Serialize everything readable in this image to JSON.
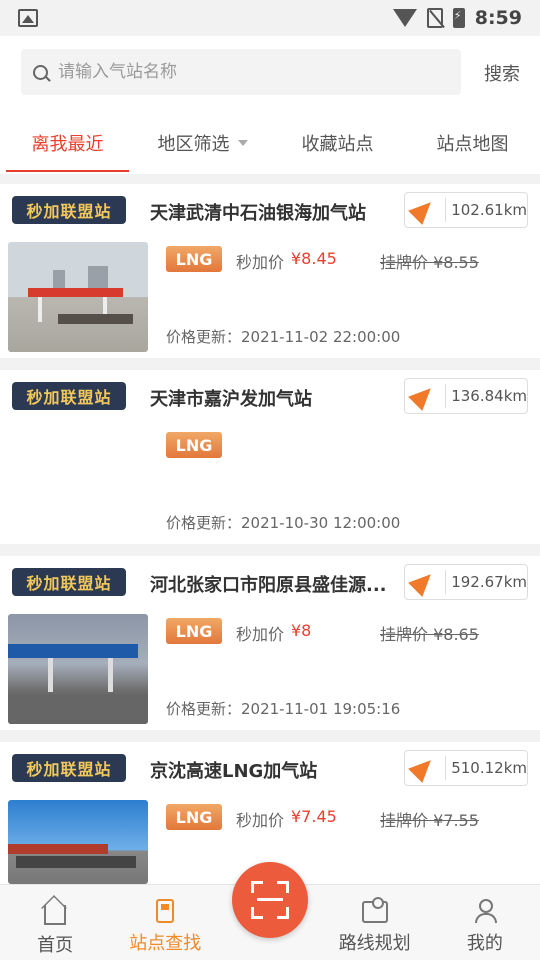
{
  "status_bar": {
    "time": "8:59"
  },
  "search": {
    "placeholder": "请输入气站名称",
    "button_label": "搜索"
  },
  "tabs": [
    {
      "label": "离我最近"
    },
    {
      "label": "地区筛选"
    },
    {
      "label": "收藏站点"
    },
    {
      "label": "站点地图"
    }
  ],
  "stations": [
    {
      "badge": "秒加联盟站",
      "name": "天津武清中石油银海加气站",
      "distance": "102.61km",
      "fuel": "LNG",
      "price_label": "秒加价",
      "price": "¥8.45",
      "list_price": "挂牌价 ¥8.55",
      "update": "价格更新：2021-11-02 22:00:00"
    },
    {
      "badge": "秒加联盟站",
      "name": "天津市嘉沪发加气站",
      "distance": "136.84km",
      "fuel": "LNG",
      "price_label": "",
      "price": "",
      "list_price": "",
      "update": "价格更新：2021-10-30 12:00:00"
    },
    {
      "badge": "秒加联盟站",
      "name": "河北张家口市阳原县盛佳源...",
      "distance": "192.67km",
      "fuel": "LNG",
      "price_label": "秒加价",
      "price": "¥8",
      "list_price": "挂牌价 ¥8.65",
      "update": "价格更新：2021-11-01 19:05:16"
    },
    {
      "badge": "秒加联盟站",
      "name": "京沈高速LNG加气站",
      "distance": "510.12km",
      "fuel": "LNG",
      "price_label": "秒加价",
      "price": "¥7.45",
      "list_price": "挂牌价 ¥7.55",
      "update": ""
    }
  ],
  "bottom_nav": [
    {
      "label": "首页",
      "icon": "home-icon"
    },
    {
      "label": "站点查找",
      "icon": "gas-pump-icon"
    },
    {
      "label": "路线规划",
      "icon": "map-icon"
    },
    {
      "label": "我的",
      "icon": "user-icon"
    }
  ],
  "colors": {
    "accent": "#e8402f",
    "orange": "#ef8a2a",
    "badge_bg": "#2b3a52",
    "badge_text": "#f2c75c"
  }
}
